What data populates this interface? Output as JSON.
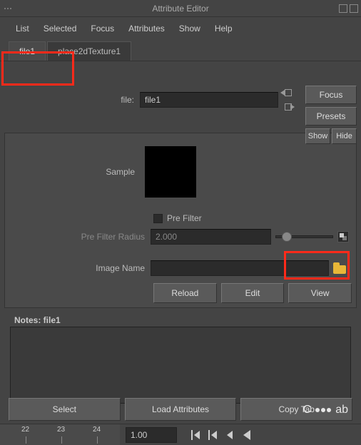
{
  "window": {
    "title": "Attribute Editor"
  },
  "menu": {
    "list": "List",
    "selected": "Selected",
    "focus": "Focus",
    "attributes": "Attributes",
    "show": "Show",
    "help": "Help"
  },
  "tabs": {
    "file": "file1",
    "place2d": "place2dTexture1"
  },
  "right_buttons": {
    "focus": "Focus",
    "presets": "Presets",
    "show": "Show",
    "hide": "Hide"
  },
  "fields": {
    "file_label": "file:",
    "file_value": "file1",
    "sample_label": "Sample",
    "prefilter_label": "Pre Filter",
    "prefilter_radius_label": "Pre Filter Radius",
    "prefilter_radius_value": "2.000",
    "image_name_label": "Image Name",
    "image_name_value": ""
  },
  "actions": {
    "reload": "Reload",
    "edit": "Edit",
    "view": "View"
  },
  "notes": {
    "label": "Notes: file1"
  },
  "bottom": {
    "select": "Select",
    "load_attributes": "Load Attributes",
    "copy_tab": "Copy Tab"
  },
  "timeline": {
    "ticks": {
      "t22": "22",
      "t23": "23",
      "t24": "24"
    },
    "current_frame": "1.00"
  }
}
